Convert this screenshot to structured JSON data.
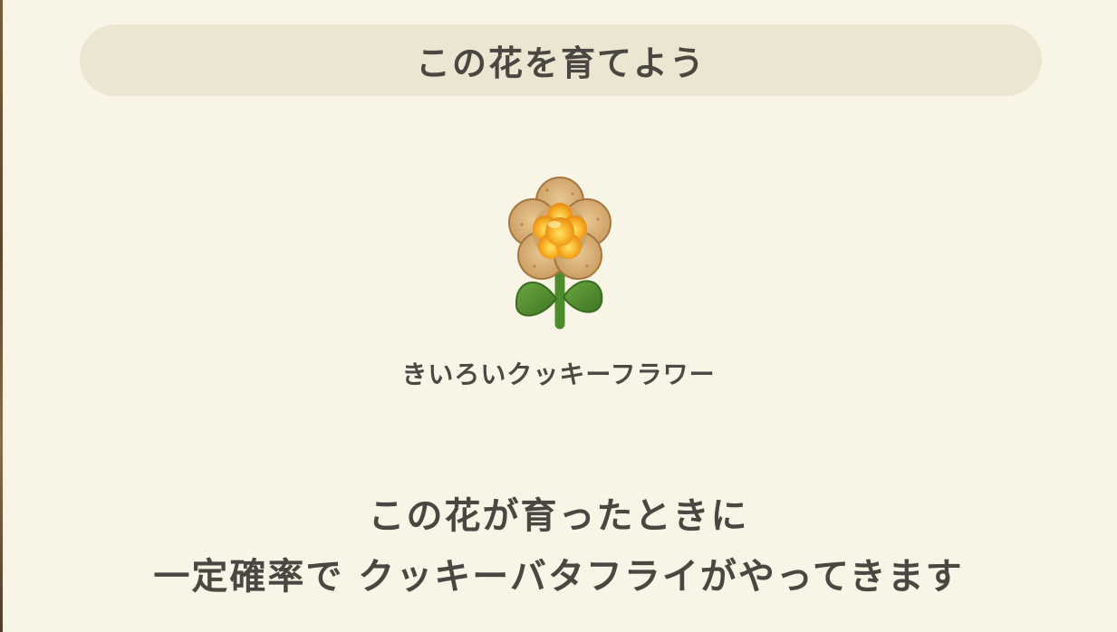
{
  "header": {
    "title": "この花を育てよう"
  },
  "flower": {
    "icon": "cookie-flower-icon",
    "name": "きいろいクッキーフラワー"
  },
  "description": {
    "line1": "この花が育ったときに",
    "line2": "一定確率で クッキーバタフライがやってきます"
  },
  "colors": {
    "background": "#f8f5e7",
    "title_bar": "#ece5d1",
    "text": "#4a4641",
    "petal": "#d9b27a",
    "center": "#f7a51c",
    "leaf": "#4f8a2e"
  }
}
